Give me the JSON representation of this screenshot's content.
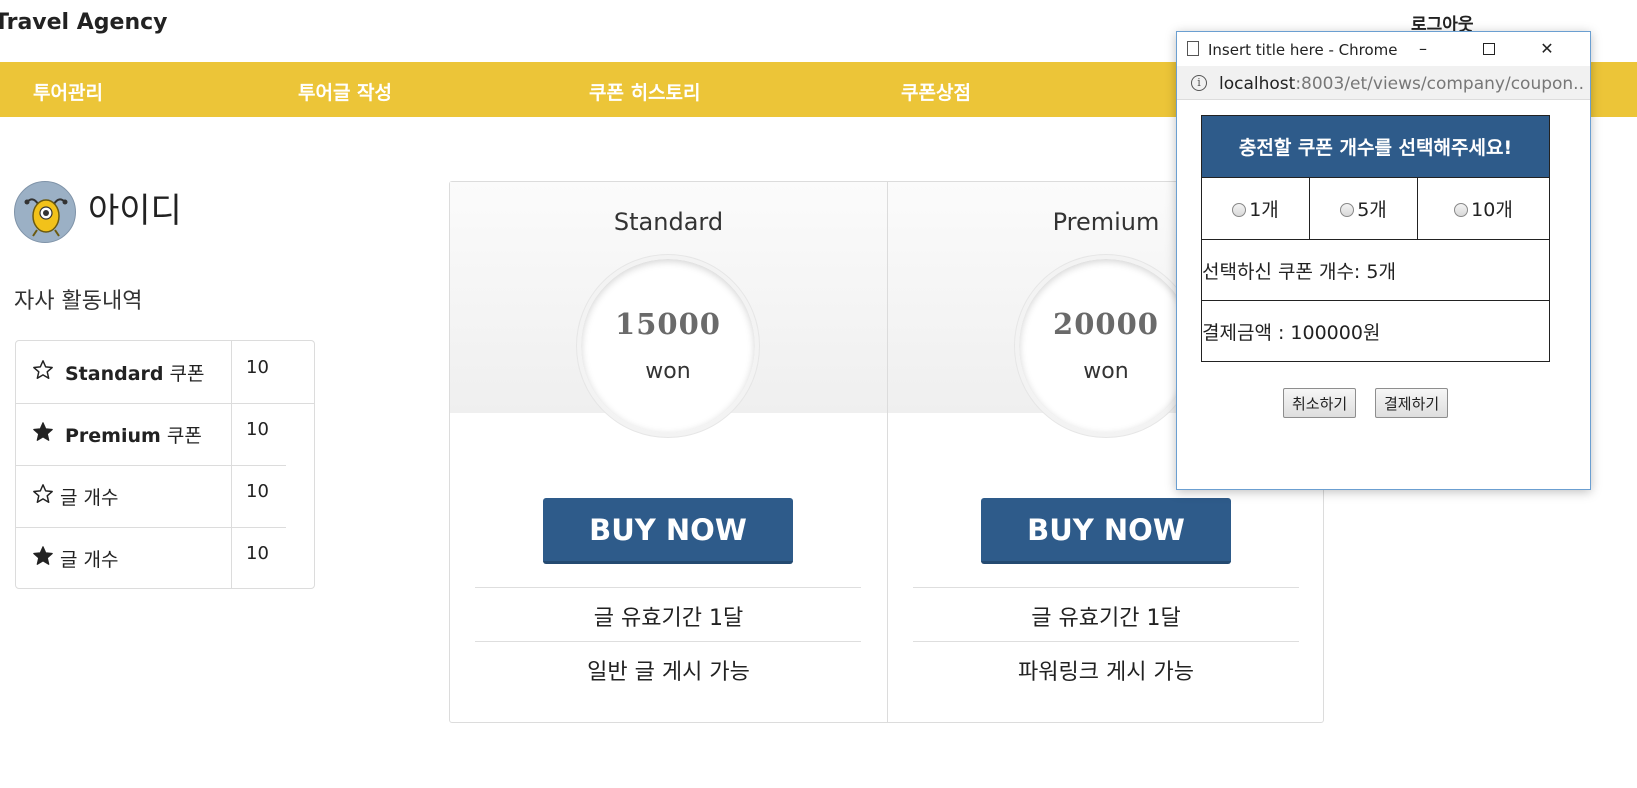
{
  "header": {
    "brand": "Travel Agency",
    "logout": "로그아웃"
  },
  "nav": {
    "items": [
      "투어관리",
      "투어글 작성",
      "쿠폰 히스토리",
      "쿠폰상점"
    ]
  },
  "colors": {
    "navbar": "#ecc538",
    "primary": "#2e5b8a"
  },
  "profile": {
    "name": "아이디",
    "activity_title": "자사 활동내역",
    "avatar_icon": "monster-avatar-icon"
  },
  "stats": [
    {
      "icon": "star-outline-icon",
      "bold": "Standard",
      "label": " 쿠폰",
      "value": "10"
    },
    {
      "icon": "star-filled-icon",
      "bold": "Premium",
      "label": " 쿠폰",
      "value": "10"
    },
    {
      "icon": "star-outline-icon",
      "bold": "",
      "label": "글 개수",
      "value": "10"
    },
    {
      "icon": "star-filled-icon",
      "bold": "",
      "label": "글 개수",
      "value": "10"
    }
  ],
  "plans": [
    {
      "name": "Standard",
      "price": "15000",
      "unit": "won",
      "button": "BUY NOW",
      "features": [
        "글 유효기간 1달",
        "일반 글 게시 가능"
      ]
    },
    {
      "name": "Premium",
      "price": "20000",
      "unit": "won",
      "button": "BUY NOW",
      "features": [
        "글 유효기간 1달",
        "파워링크 게시 가능"
      ]
    }
  ],
  "popup": {
    "window_title": "Insert title here - Chrome",
    "url_host": "localhost",
    "url_rest": ":8003/et/views/company/coupon...",
    "heading": "충전할 쿠폰 개수를 선택해주세요!",
    "options": [
      "1개",
      "5개",
      "10개"
    ],
    "selected_count": "선택하신 쿠폰 개수: 5개",
    "payment": "결제금액 : 100000원",
    "cancel_label": "취소하기",
    "pay_label": "결제하기"
  }
}
